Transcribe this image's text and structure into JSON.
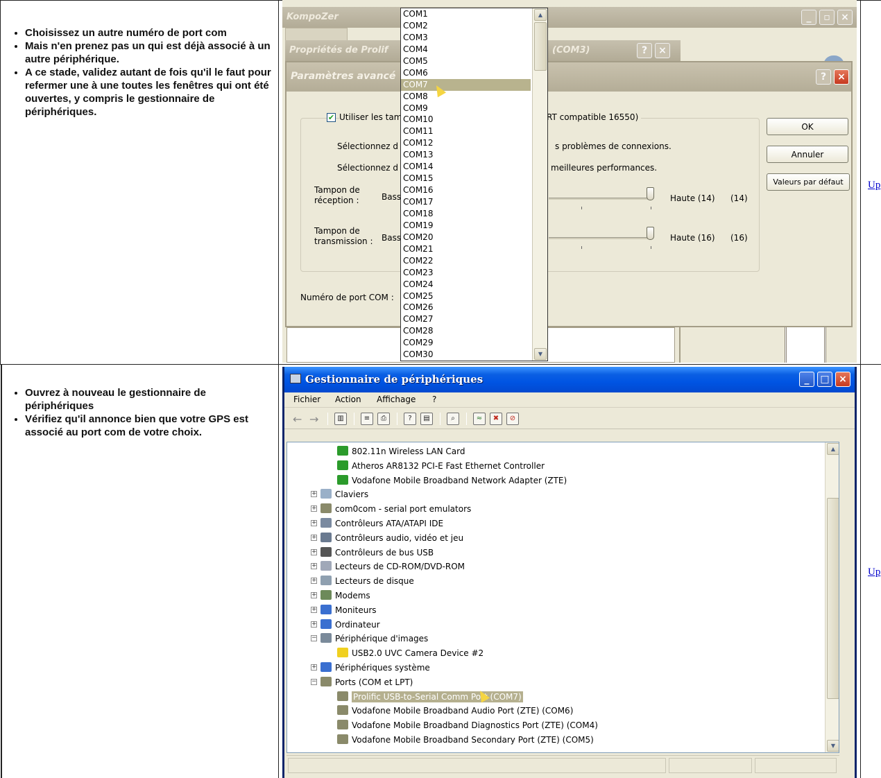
{
  "row1": {
    "bullets": [
      "Choisissez un autre numéro de port com",
      "Mais n'en prenez pas un qui est déjà associé à un autre périphérique.",
      "A ce stade, validez autant de fois qu'il le faut pour refermer une à une toutes les fenêtres qui ont été ouvertes, y compris le gestionnaire de périphériques."
    ],
    "up_link": "Up"
  },
  "row2": {
    "bullets": [
      "Ouvrez à nouveau le gestionnaire de périphériques",
      "Vérifiez qu'il annonce bien que votre GPS est associé au port com de votre choix."
    ],
    "up_link": "Up"
  },
  "shot1": {
    "kompozer_title": "KompoZer",
    "props_title": "Propriétés de Prolif",
    "props_title_suffix": "(COM3)",
    "dialog_title": "Paramètres avancé",
    "use_fifo_label": "Utiliser les tamp",
    "fifo_suffix": "RT compatible 16550)",
    "fifo_checked": true,
    "select_lower_label": "Sélectionnez d",
    "select_lower_suffix": "s problèmes de connexions.",
    "select_higher_label": "Sélectionnez d",
    "select_higher_suffix": "meilleures performances.",
    "rx_label": "Tampon de réception :",
    "rx_low": "Bass",
    "rx_high": "Haute (14)",
    "rx_value": "(14)",
    "tx_label": "Tampon de transmission :",
    "tx_low": "Bass",
    "tx_high": "Haute (16)",
    "tx_value": "(16)",
    "port_label": "Numéro de port COM :",
    "ok": "OK",
    "cancel": "Annuler",
    "defaults": "Valeurs par défaut",
    "help": "?",
    "close": "×",
    "com_options": [
      "COM1",
      "COM2",
      "COM3",
      "COM4",
      "COM5",
      "COM6",
      "COM7",
      "COM8",
      "COM9",
      "COM10",
      "COM11",
      "COM12",
      "COM13",
      "COM14",
      "COM15",
      "COM16",
      "COM17",
      "COM18",
      "COM19",
      "COM20",
      "COM21",
      "COM22",
      "COM23",
      "COM24",
      "COM25",
      "COM26",
      "COM27",
      "COM28",
      "COM29",
      "COM30"
    ],
    "selected_com": "COM7"
  },
  "shot2": {
    "title": "Gestionnaire de périphériques",
    "menu": [
      "Fichier",
      "Action",
      "Affichage",
      "?"
    ],
    "tree": [
      {
        "label": "802.11n Wireless LAN Card",
        "icon": "network-card-icon",
        "color": "#2b9b2b"
      },
      {
        "label": "Atheros AR8132 PCI-E Fast Ethernet Controller",
        "icon": "network-card-icon",
        "color": "#2b9b2b"
      },
      {
        "label": "Vodafone Mobile Broadband Network Adapter (ZTE)",
        "icon": "network-card-icon",
        "color": "#2b9b2b"
      },
      {
        "label": "Claviers",
        "icon": "keyboard-icon",
        "color": "#9ab0c8"
      },
      {
        "label": "com0com - serial port emulators",
        "icon": "port-icon",
        "color": "#8a8a6a"
      },
      {
        "label": "Contrôleurs ATA/ATAPI IDE",
        "icon": "ide-controller-icon",
        "color": "#7a8aa0"
      },
      {
        "label": "Contrôleurs audio, vidéo et jeu",
        "icon": "audio-icon",
        "color": "#6a7a90"
      },
      {
        "label": "Contrôleurs de bus USB",
        "icon": "usb-icon",
        "color": "#555"
      },
      {
        "label": "Lecteurs de CD-ROM/DVD-ROM",
        "icon": "cdrom-icon",
        "color": "#a0a8b8"
      },
      {
        "label": "Lecteurs de disque",
        "icon": "disk-icon",
        "color": "#8fa0b0"
      },
      {
        "label": "Modems",
        "icon": "modem-icon",
        "color": "#6d8a5a"
      },
      {
        "label": "Moniteurs",
        "icon": "monitor-icon",
        "color": "#3a6fd0"
      },
      {
        "label": "Ordinateur",
        "icon": "computer-icon",
        "color": "#3a6fd0"
      },
      {
        "label": "Périphérique d'images",
        "icon": "camera-icon",
        "color": "#7a8a9a"
      },
      {
        "label": "USB2.0 UVC Camera Device #2",
        "icon": "warning-icon",
        "color": "#f0d020"
      },
      {
        "label": "Périphériques système",
        "icon": "system-icon",
        "color": "#3a6fd0"
      },
      {
        "label": "Ports (COM et LPT)",
        "icon": "port-icon",
        "color": "#8a8a6a"
      },
      {
        "label": "Prolific USB-to-Serial Comm Port (COM7)",
        "icon": "port-icon",
        "color": "#8a8a6a"
      },
      {
        "label": "Vodafone Mobile Broadband Audio Port (ZTE) (COM6)",
        "icon": "port-icon",
        "color": "#8a8a6a"
      },
      {
        "label": "Vodafone Mobile Broadband Diagnostics Port (ZTE) (COM4)",
        "icon": "port-icon",
        "color": "#8a8a6a"
      },
      {
        "label": "Vodafone Mobile Broadband Secondary Port (ZTE) (COM5)",
        "icon": "port-icon",
        "color": "#8a8a6a"
      }
    ],
    "selected_item": "Prolific USB-to-Serial Comm Port (COM7)"
  },
  "colors": {
    "xp_title_blue": "#0054e3",
    "xp_face": "#ece9d8",
    "selection_disabled": "#b5b08f",
    "link": "#0000cc"
  }
}
